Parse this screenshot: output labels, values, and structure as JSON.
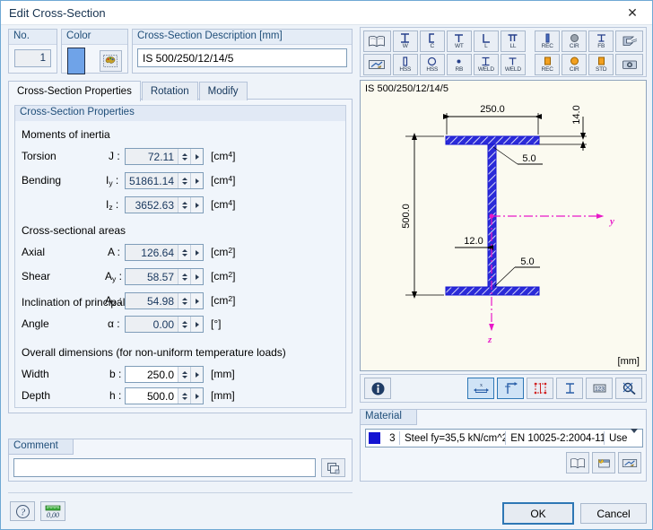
{
  "window": {
    "title": "Edit Cross-Section",
    "close_icon": "close-icon"
  },
  "header": {
    "no_label": "No.",
    "no_value": "1",
    "color_label": "Color",
    "color_swatch": "#6fa3e8",
    "palette_icon": "color-palette-icon",
    "description_label": "Cross-Section Description [mm]",
    "description_value": "IS 500/250/12/14/5"
  },
  "tabs": [
    {
      "label": "Cross-Section Properties",
      "active": true
    },
    {
      "label": "Rotation",
      "active": false
    },
    {
      "label": "Modify",
      "active": false
    }
  ],
  "properties": {
    "group_caption": "Cross-Section Properties",
    "sections": [
      {
        "title": "Moments of inertia"
      },
      {
        "title": "Cross-sectional areas"
      },
      {
        "title": "Inclination of principal axes"
      },
      {
        "title": "Overall dimensions (for non-uniform temperature loads)"
      }
    ],
    "rows": [
      {
        "label": "Torsion",
        "symbol": "J",
        "value": "72.11",
        "unit": "cm4",
        "editable": false
      },
      {
        "label": "Bending",
        "symbol": "Iy",
        "value": "51861.14",
        "unit": "cm4",
        "editable": false
      },
      {
        "label": "",
        "symbol": "Iz",
        "value": "3652.63",
        "unit": "cm4",
        "editable": false
      },
      {
        "label": "Axial",
        "symbol": "A",
        "value": "126.64",
        "unit": "cm2",
        "editable": false
      },
      {
        "label": "Shear",
        "symbol": "Ay",
        "value": "58.57",
        "unit": "cm2",
        "editable": false
      },
      {
        "label": "",
        "symbol": "Az",
        "value": "54.98",
        "unit": "cm2",
        "editable": false
      },
      {
        "label": "Angle",
        "symbol": "α",
        "value": "0.00",
        "unit": "°",
        "editable": false
      },
      {
        "label": "Width",
        "symbol": "b",
        "value": "250.0",
        "unit": "mm",
        "editable": true
      },
      {
        "label": "Depth",
        "symbol": "h",
        "value": "500.0",
        "unit": "mm",
        "editable": true
      }
    ]
  },
  "comment": {
    "caption": "Comment",
    "value": "",
    "copy_icon": "copy-pages-icon"
  },
  "footer_tools": [
    {
      "icon": "help-question-icon",
      "name": "help-button"
    },
    {
      "icon": "units-decimal-icon",
      "name": "units-button"
    }
  ],
  "shape_toolbar": {
    "row1": [
      {
        "icon": "library-book-icon",
        "label": "",
        "name": "section-library-button"
      },
      {
        "icon": "i-profile-icon",
        "label": "W",
        "name": "shape-w-button"
      },
      {
        "icon": "c-profile-icon",
        "label": "C",
        "name": "shape-c-button"
      },
      {
        "icon": "t-profile-icon",
        "label": "WT",
        "name": "shape-wt-button"
      },
      {
        "icon": "l-profile-icon",
        "label": "L",
        "name": "shape-l-button"
      },
      {
        "icon": "ll-profile-icon",
        "label": "LL",
        "name": "shape-ll-button"
      },
      {
        "icon": "rect-bar-icon",
        "label": "REC",
        "name": "shape-rec-button"
      },
      {
        "icon": "circle-bar-icon",
        "label": "CIR",
        "name": "shape-cir-button"
      },
      {
        "icon": "flat-bar-icon",
        "label": "FB",
        "name": "shape-fb-button"
      },
      {
        "icon": "thin-walled-icon",
        "label": "",
        "name": "thin-walled-button"
      }
    ],
    "row2": [
      {
        "icon": "parametric-icon",
        "label": "",
        "name": "parametric-button"
      },
      {
        "icon": "hss-rect-icon",
        "label": "HSS",
        "name": "shape-hss-rect-button"
      },
      {
        "icon": "hss-round-icon",
        "label": "HSS",
        "name": "shape-hss-round-button"
      },
      {
        "icon": "round-bar-icon",
        "label": "RB",
        "name": "shape-rb-button"
      },
      {
        "icon": "weld-i-icon",
        "label": "WELD",
        "name": "shape-weld-i-button"
      },
      {
        "icon": "weld-t-icon",
        "label": "WELD",
        "name": "shape-weld-t-button"
      },
      {
        "icon": "solid-rect-icon",
        "label": "REC",
        "name": "shape-solid-rec-button"
      },
      {
        "icon": "solid-circle-icon",
        "label": "CIR",
        "name": "shape-solid-cir-button"
      },
      {
        "icon": "standard-icon",
        "label": "STD",
        "name": "shape-std-button"
      },
      {
        "icon": "camera-icon",
        "label": "",
        "name": "view-button"
      }
    ]
  },
  "drawing": {
    "title": "IS 500/250/12/14/5",
    "unit_note": "[mm]",
    "dimensions": {
      "width_top": "250.0",
      "flange_thickness": "14.0",
      "fillet_top": "5.0",
      "depth": "500.0",
      "web_thickness": "12.0",
      "fillet_bottom": "5.0"
    },
    "axes": {
      "horizontal": "y",
      "vertical": "z",
      "color": "#e818c8"
    },
    "section_color": "#1414d2"
  },
  "drawing_toolbar": [
    {
      "icon": "info-icon",
      "name": "drawing-info-button",
      "active": false
    },
    {
      "icon": "dimension-x-icon",
      "name": "dimension-width-button",
      "active": true
    },
    {
      "icon": "axes-icon",
      "name": "show-axes-button",
      "active": true
    },
    {
      "icon": "dimension-lines-icon",
      "name": "dimension-lines-button",
      "active": false
    },
    {
      "icon": "parts-icon",
      "name": "show-parts-button",
      "active": false
    },
    {
      "icon": "numbers-icon",
      "name": "show-numbers-button",
      "active": false
    },
    {
      "icon": "zoom-reset-icon",
      "name": "zoom-reset-button",
      "active": false
    }
  ],
  "material": {
    "caption": "Material",
    "swatch": "#1414d2",
    "number": "3",
    "name": "Steel fy=35,5 kN/cm^2",
    "standard": "EN 10025-2:2004-11",
    "extra": "Use",
    "buttons": [
      {
        "icon": "library-book-icon",
        "name": "material-library-button"
      },
      {
        "icon": "new-material-icon",
        "name": "new-material-button"
      },
      {
        "icon": "edit-material-icon",
        "name": "edit-material-button"
      }
    ]
  },
  "footer": {
    "ok": "OK",
    "cancel": "Cancel"
  }
}
